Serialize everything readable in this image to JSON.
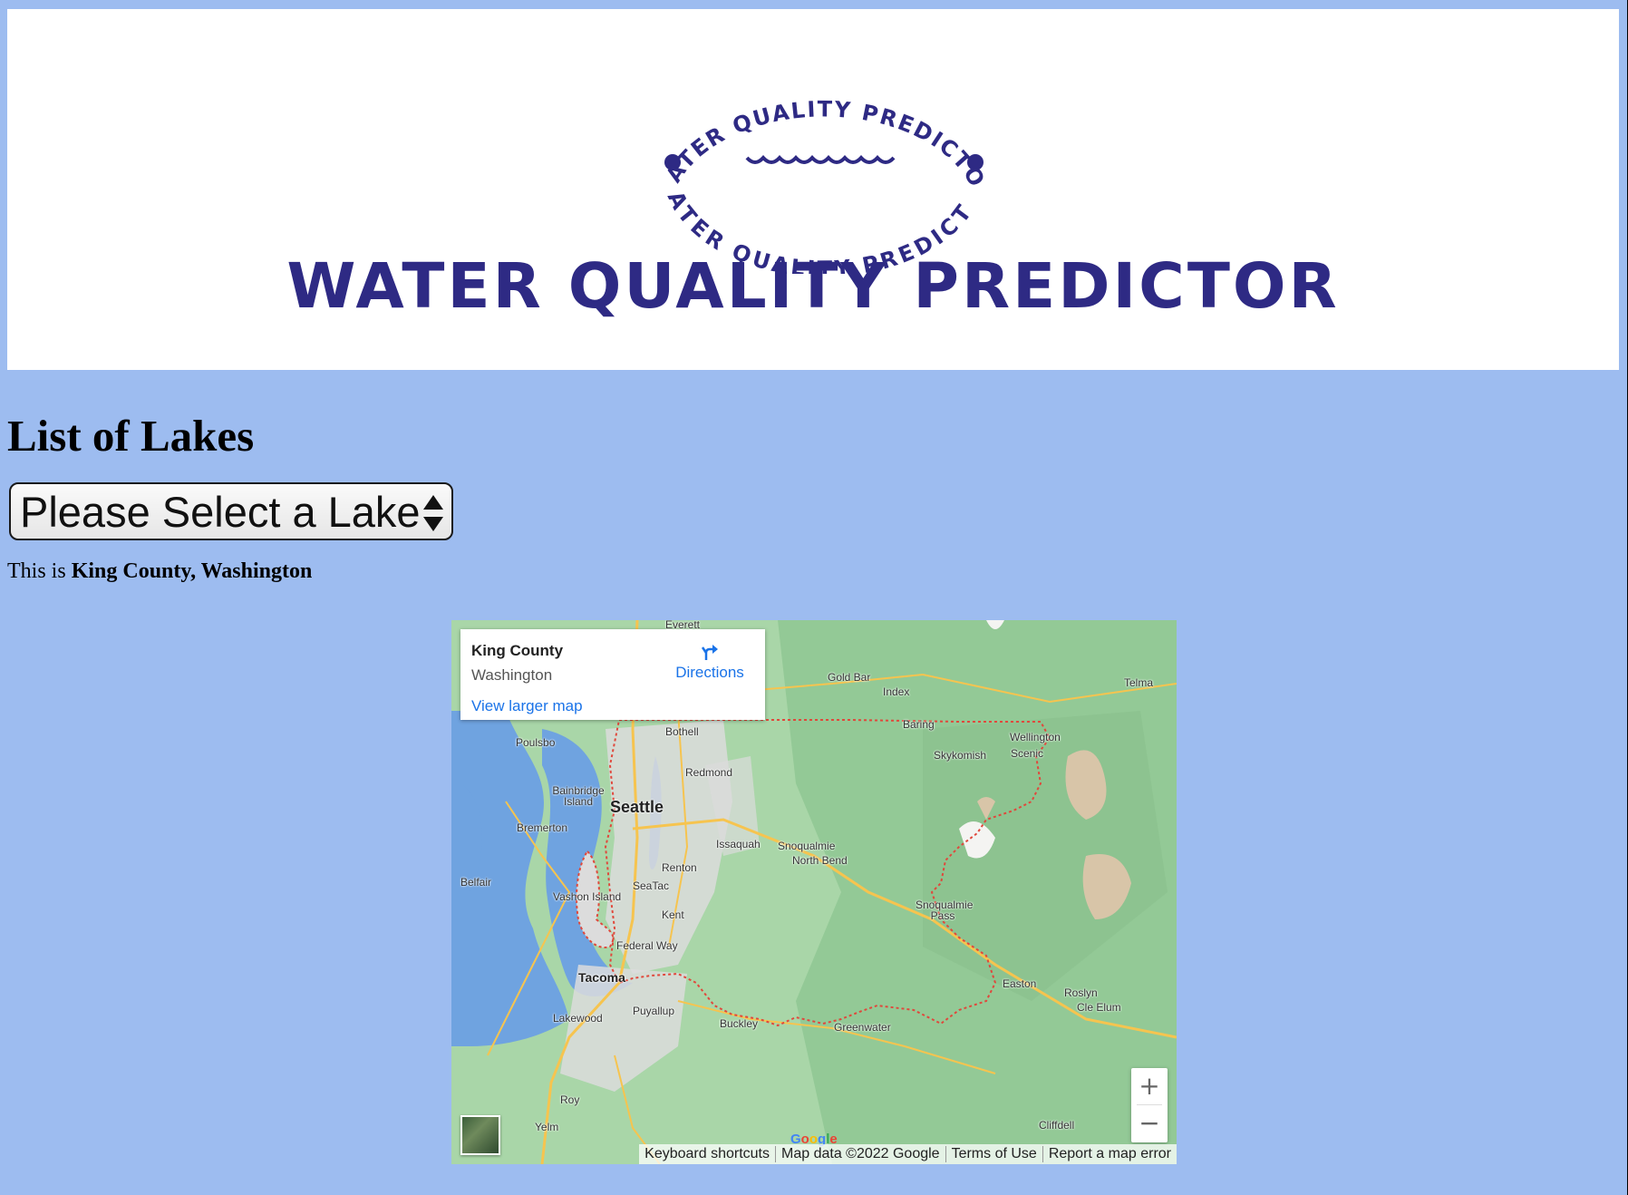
{
  "banner": {
    "logo_ring_text": "WATER QUALITY PREDICTOR",
    "wordmark": "WATER QUALITY PREDICTOR"
  },
  "heading": "List of Lakes",
  "lake_select": {
    "selected_label": "Please Select a Lake"
  },
  "county_line": {
    "prefix": "This is",
    "place": "King County, Washington"
  },
  "map": {
    "info_card": {
      "title": "King County",
      "subtitle": "Washington",
      "directions_label": "Directions",
      "view_larger_label": "View larger map"
    },
    "place_labels": [
      "Everett",
      "Gold Bar",
      "Index",
      "Telma",
      "Baring",
      "Bothell",
      "Poulsbo",
      "Wellington",
      "Scenic",
      "Skykomish",
      "Redmond",
      "Bainbridge Island",
      "Seattle",
      "Bremerton",
      "Issaquah",
      "Snoqualmie",
      "North Bend",
      "Renton",
      "Belfair",
      "SeaTac",
      "Vashon Island",
      "Kent",
      "Snoqualmie Pass",
      "Federal Way",
      "Tacoma",
      "Easton",
      "Roslyn",
      "Cle Elum",
      "Puyallup",
      "Lakewood",
      "Buckley",
      "Greenwater",
      "Roy",
      "Yelm",
      "Cliffdell"
    ],
    "zoom_in_label": "+",
    "zoom_out_label": "−",
    "google_label": "Google",
    "attribution": {
      "shortcuts": "Keyboard shortcuts",
      "map_data": "Map data ©2022 Google",
      "terms": "Terms of Use",
      "report": "Report a map error"
    }
  },
  "colors": {
    "page_background": "#9dbcf0",
    "brand_navy": "#2e2a84",
    "map_link_blue": "#1a73e8",
    "county_boundary": "#e0483c"
  }
}
